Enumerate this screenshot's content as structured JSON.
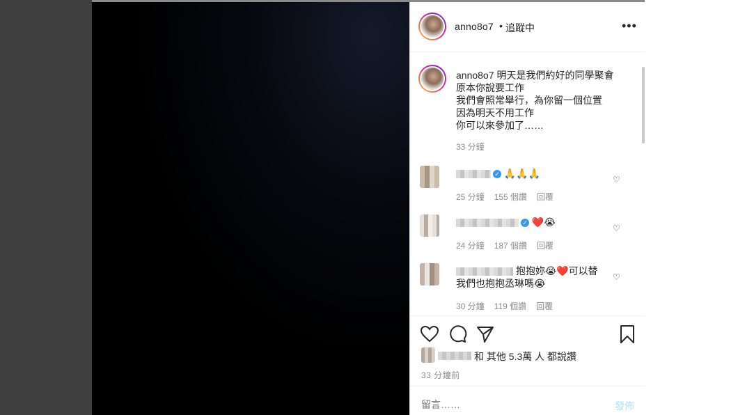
{
  "header": {
    "username": "anno8o7",
    "separator": "•",
    "follow_status": "追蹤中",
    "more_icon": "•••"
  },
  "caption": {
    "username": "anno8o7",
    "lines": [
      "明天是我們約好的同學聚會",
      "原本你說要工作",
      "我們會照常舉行，為你留一個位置",
      "因為明天不用工作",
      "你可以來參加了……"
    ],
    "time": "33 分鐘"
  },
  "comments": [
    {
      "text": "🙏🙏🙏",
      "time": "25 分鐘",
      "likes": "155 個讚",
      "reply": "回覆",
      "verified": true
    },
    {
      "text": "❤️😭",
      "time": "24 分鐘",
      "likes": "187 個讚",
      "reply": "回覆",
      "verified": true
    },
    {
      "text": "抱抱妳😭❤️可以替",
      "text2": "我們也抱抱丞琳嗎😭",
      "time": "30 分鐘",
      "likes": "119 個讚",
      "reply": "回覆",
      "verified": false
    }
  ],
  "actions": {
    "likes_text": "和 其他 5.3萬 人 都說讚",
    "post_time": "33 分鐘前",
    "comment_placeholder": "留言……",
    "post_label": "發佈"
  },
  "icons": [
    "heart-icon",
    "comment-icon",
    "share-icon",
    "bookmark-icon",
    "more-icon",
    "verified-icon"
  ]
}
